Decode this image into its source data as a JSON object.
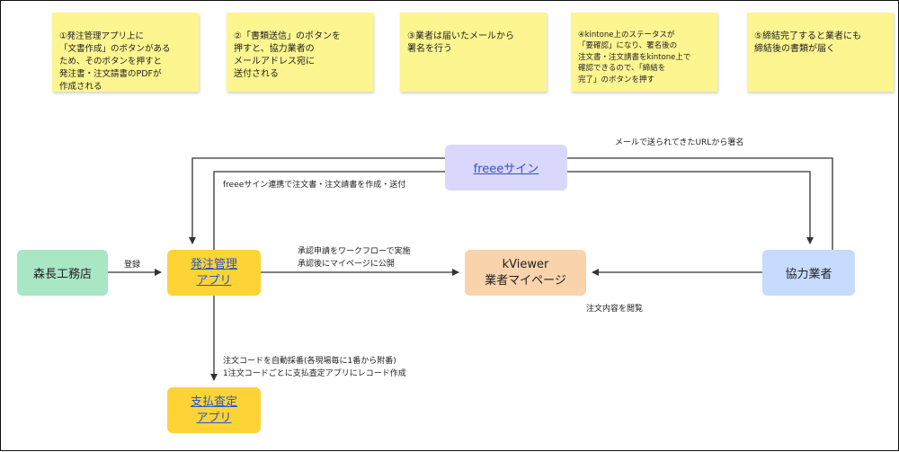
{
  "notes": [
    "①発注管理アプリ上に\n「文書作成」のボタンがある\nため、そのボタンを押すと\n発注書・注文請書のPDFが\n作成される",
    "②「書類送信」のボタンを\n押すと、協力業者の\nメールアドレス宛に\n送付される",
    "③業者は届いたメールから\n署名を行う",
    "④kintone上のステータスが\n「要確認」になり、署名後の\n注文書・注文請書をkintone上で\n確認できるので、「締結を\n完了」のボタンを押す",
    "⑤締結完了すると業者にも\n締結後の書類が届く"
  ],
  "nodes": {
    "morinaga": "森長工務店",
    "hachu": "発注管理\nアプリ",
    "freee": "freeeサイン",
    "kviewer": "kViewer\n業者マイページ",
    "kyoryoku": "協力業者",
    "shiharai": "支払査定\nアプリ"
  },
  "edge_labels": {
    "mail_sign": "メールで送られてきたURLから署名",
    "freee_link": "freeeサイン連携で注文書・注文請書を作成・送付",
    "touroku": "登録",
    "shonin": "承認申請をワークフローで実施\n承認後にマイページに公開",
    "etsuran": "注文内容を閲覧",
    "code": "注文コードを自動採番(各現場毎に1番から附番)\n1注文コードごとに支払査定アプリにレコード作成"
  },
  "colors": {
    "sticky": "#fdf58f",
    "green": "#a9e6c4",
    "yellow": "#fdd336",
    "purple": "#dad7fd",
    "peach": "#f8d3ac",
    "blue": "#c6dbfd",
    "link": "#2a56c6"
  }
}
